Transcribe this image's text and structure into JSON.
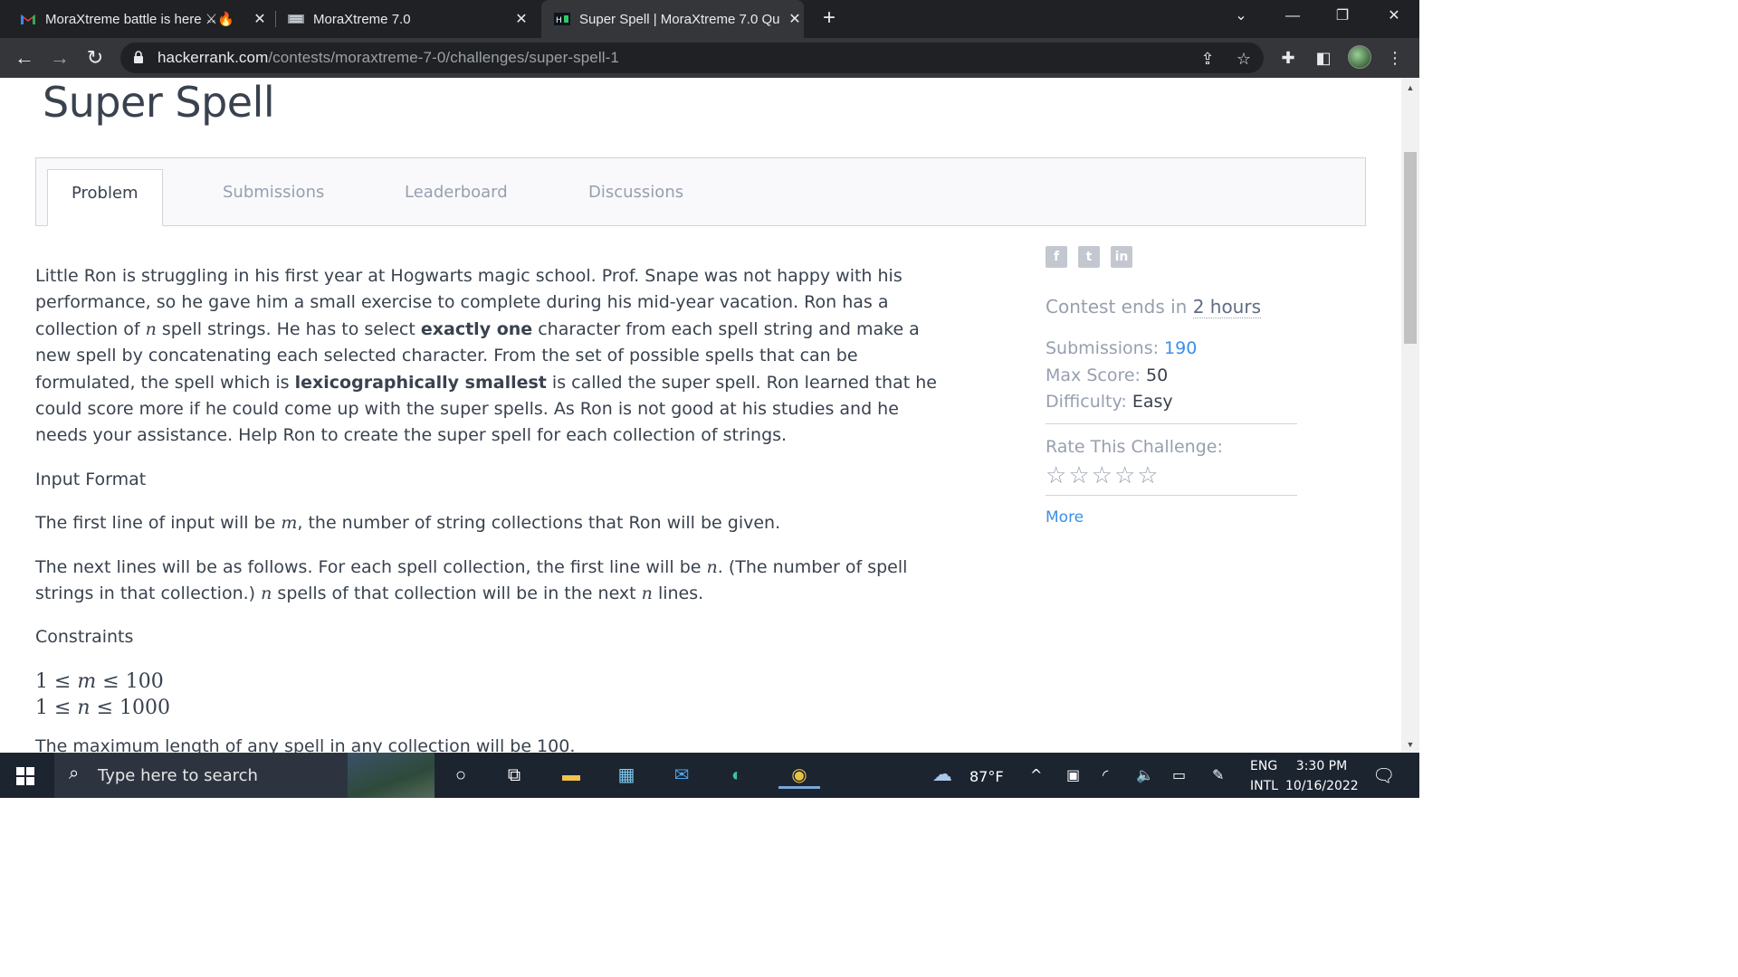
{
  "browser": {
    "tabs": [
      {
        "title": "MoraXtreme battle is here ⚔🔥",
        "active": false
      },
      {
        "title": "MoraXtreme 7.0",
        "active": false
      },
      {
        "title": "Super Spell | MoraXtreme 7.0 Qu",
        "active": true
      }
    ],
    "url_host": "hackerrank.com",
    "url_path": "/contests/moraxtreme-7-0/challenges/super-spell-1"
  },
  "page": {
    "title": "Super Spell",
    "tabs": [
      "Problem",
      "Submissions",
      "Leaderboard",
      "Discussions"
    ],
    "intro": {
      "p1a": "Little Ron is struggling in his first year at Hogwarts magic school. Prof. Snape was not happy with his performance, so he gave him a small exercise to complete during his mid-year vacation. Ron has a collection of ",
      "n": "n",
      "p1b": " spell strings. He has to select ",
      "bold1": "exactly one",
      "p1c": " character from each spell string and make a new spell by concatenating each selected character. From the set of possible spells that can be formulated, the spell which is ",
      "bold2": "lexicographically smallest",
      "p1d": " is called the super spell. Ron learned that he could score more if he could come up with the super spells. As Ron is not good at his studies and he needs your assistance. Help Ron to create the super spell for each collection of strings."
    },
    "input_format": {
      "heading": "Input Format",
      "line1a": "The first line of input will be ",
      "m": "m",
      "line1b": ", the number of string collections that Ron will be given.",
      "line2a": "The next lines will be as follows. For each spell collection, the first line will be ",
      "line2b": ". (The number of spell strings in that collection.) ",
      "line2c": " spells of that collection will be in the next ",
      "line2d": " lines."
    },
    "constraints": {
      "heading": "Constraints",
      "c1_lo": "1",
      "c1_var": "m",
      "c1_hi": "100",
      "c2_lo": "1",
      "c2_var": "n",
      "c2_hi": "1000",
      "c3": "The maximum length of any spell in any collection will be 100."
    },
    "sidebar": {
      "social": [
        "f",
        "t",
        "in"
      ],
      "contest_ends_label": "Contest ends in ",
      "contest_ends_value": "2 hours",
      "submissions_label": "Submissions: ",
      "submissions_value": "190",
      "max_score_label": "Max Score: ",
      "max_score_value": "50",
      "difficulty_label": "Difficulty: ",
      "difficulty_value": "Easy",
      "rate_label": "Rate This Challenge:",
      "rating": 0,
      "more": "More"
    }
  },
  "taskbar": {
    "search_placeholder": "Type here to search",
    "weather": "87°F",
    "lang_top": "ENG",
    "lang_bottom": "INTL",
    "time": "3:30 PM",
    "date": "10/16/2022"
  }
}
